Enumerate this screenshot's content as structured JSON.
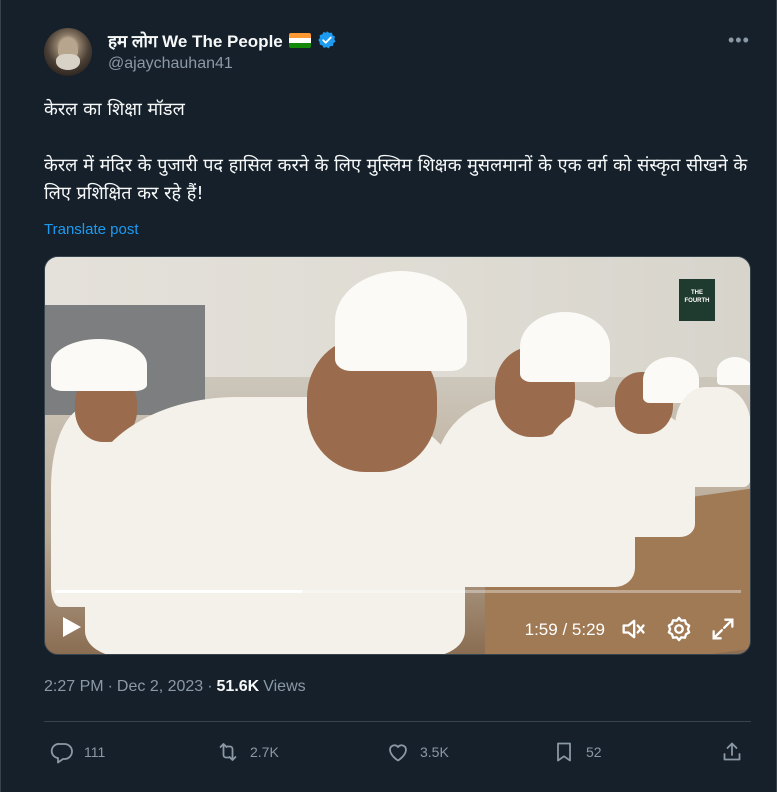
{
  "author": {
    "display_name": "हम लोग We The People",
    "handle": "@ajaychauhan41",
    "verified_color": "#1d9bf0",
    "flag_colors": [
      "#ff9933",
      "#ffffff",
      "#138808"
    ]
  },
  "tweet": {
    "paragraph_1": "केरल का शिक्षा मॉडल",
    "paragraph_2": "केरल में मंदिर के पुजारी पद हासिल करने के लिए मुस्लिम शिक्षक मुसलमानों के एक वर्ग को संस्कृत सीखने के लिए प्रशिक्षित कर रहे हैं!",
    "translate_label": "Translate post"
  },
  "video": {
    "logo_line1": "THE",
    "logo_line2": "FOURTH",
    "current_time": "1:59",
    "separator": "/",
    "duration": "5:29",
    "progress": 0.36,
    "icons": [
      "play-icon",
      "volume-icon",
      "settings-icon",
      "fullscreen-icon"
    ]
  },
  "meta": {
    "time": "2:27 PM",
    "dot": "·",
    "date": "Dec 2, 2023",
    "views_count": "51.6K",
    "views_label": "Views"
  },
  "actions": {
    "replies": "111",
    "reposts": "2.7K",
    "likes": "3.5K",
    "bookmarks": "52"
  },
  "colors": {
    "background": "#15202b",
    "text": "#f7f9f9",
    "secondary": "#8b98a5",
    "link": "#1d9bf0",
    "border": "#38444d"
  }
}
